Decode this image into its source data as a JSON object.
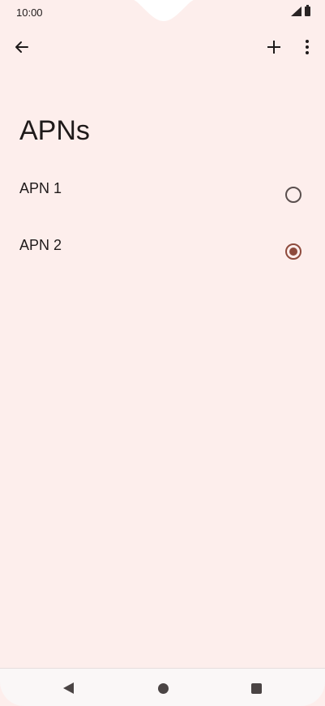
{
  "status_bar": {
    "time": "10:00",
    "icons": [
      "signal-icon",
      "battery-icon"
    ]
  },
  "toolbar": {
    "back_icon": "arrow-left-icon",
    "add_icon": "plus-icon",
    "more_icon": "more-vertical-icon"
  },
  "page": {
    "title": "APNs"
  },
  "apns": [
    {
      "label": "APN 1",
      "selected": false
    },
    {
      "label": "APN 2",
      "selected": true
    }
  ],
  "colors": {
    "background": "#fdeeec",
    "accent": "#8e4a3c",
    "text": "#1f1a1a"
  },
  "nav_bar": {
    "icons": [
      "nav-back-icon",
      "nav-home-icon",
      "nav-recents-icon"
    ]
  }
}
